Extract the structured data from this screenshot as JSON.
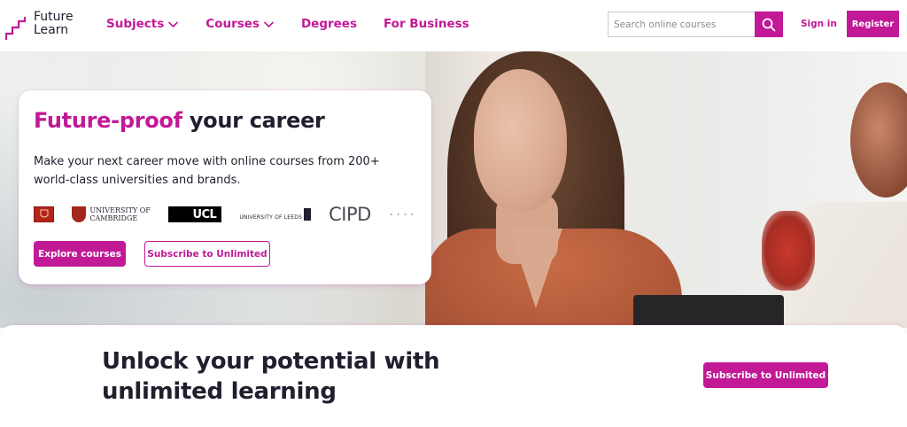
{
  "brand": {
    "name_line1": "Future",
    "name_line2": "Learn",
    "accent_color": "#c21997"
  },
  "nav": {
    "items": [
      {
        "label": "Subjects",
        "has_dropdown": true
      },
      {
        "label": "Courses",
        "has_dropdown": true
      },
      {
        "label": "Degrees",
        "has_dropdown": false
      },
      {
        "label": "For Business",
        "has_dropdown": false
      }
    ]
  },
  "search": {
    "placeholder": "Search online courses",
    "icon": "search-icon"
  },
  "account": {
    "signin_label": "Sign in",
    "register_label": "Register"
  },
  "hero": {
    "title_accent": "Future-proof",
    "title_rest": "your career",
    "description": "Make your next career move with online courses from 200+ world-class universities and brands.",
    "partners": {
      "cambridge_line1": "UNIVERSITY OF",
      "cambridge_line2": "CAMBRIDGE",
      "ucl": "UCL",
      "leeds": "UNIVERSITY OF LEEDS",
      "cipd": "CIPD"
    },
    "explore_label": "Explore courses",
    "subscribe_label": "Subscribe to Unlimited"
  },
  "band": {
    "title": "Unlock your potential with unlimited learning",
    "subscribe_label": "Subscribe to Unlimited"
  }
}
